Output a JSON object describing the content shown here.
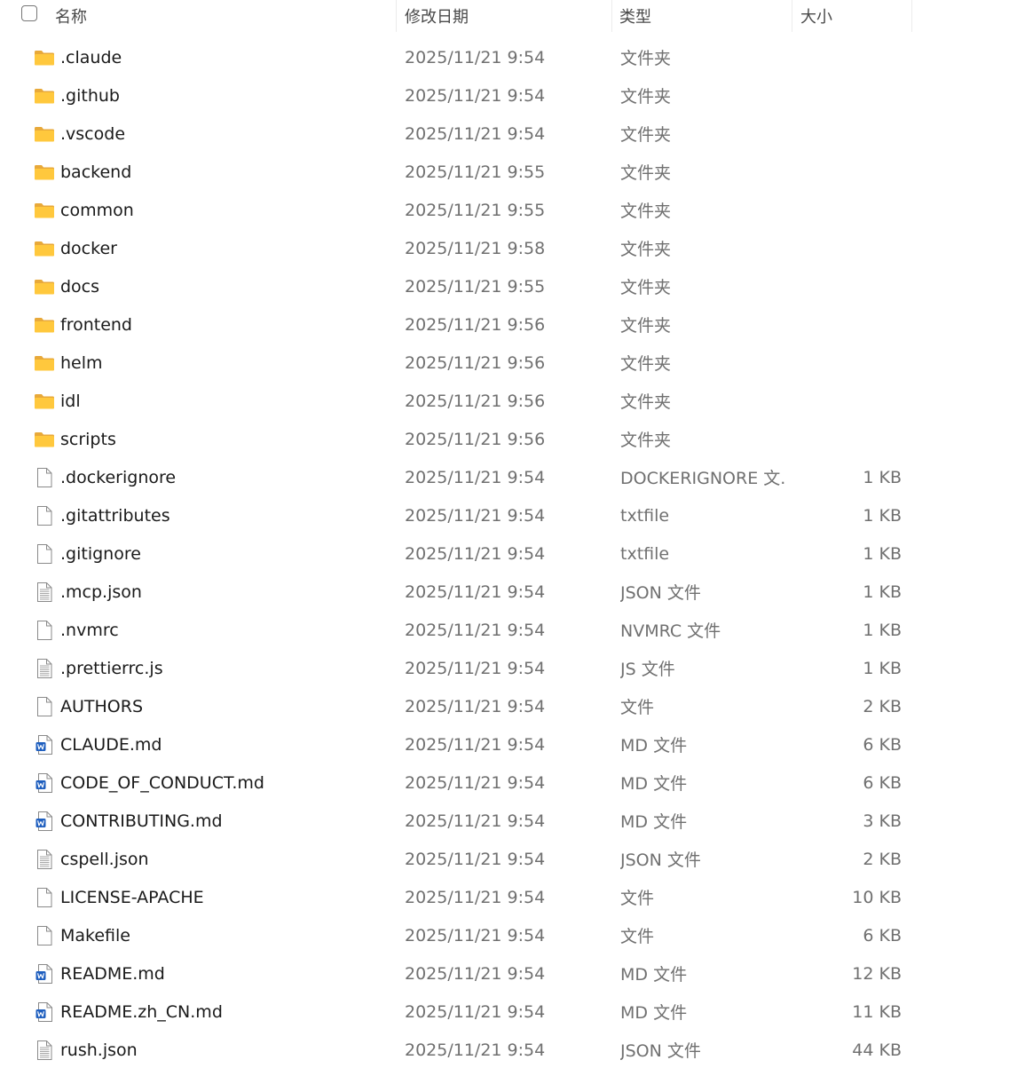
{
  "header": {
    "name_label": "名称",
    "date_label": "修改日期",
    "type_label": "类型",
    "size_label": "大小"
  },
  "files": [
    {
      "name": ".claude",
      "date": "2025/11/21 9:54",
      "type": "文件夹",
      "size": "",
      "icon": "folder-icon"
    },
    {
      "name": ".github",
      "date": "2025/11/21 9:54",
      "type": "文件夹",
      "size": "",
      "icon": "folder-icon"
    },
    {
      "name": ".vscode",
      "date": "2025/11/21 9:54",
      "type": "文件夹",
      "size": "",
      "icon": "folder-icon"
    },
    {
      "name": "backend",
      "date": "2025/11/21 9:55",
      "type": "文件夹",
      "size": "",
      "icon": "folder-icon"
    },
    {
      "name": "common",
      "date": "2025/11/21 9:55",
      "type": "文件夹",
      "size": "",
      "icon": "folder-icon"
    },
    {
      "name": "docker",
      "date": "2025/11/21 9:58",
      "type": "文件夹",
      "size": "",
      "icon": "folder-icon"
    },
    {
      "name": "docs",
      "date": "2025/11/21 9:55",
      "type": "文件夹",
      "size": "",
      "icon": "folder-icon"
    },
    {
      "name": "frontend",
      "date": "2025/11/21 9:56",
      "type": "文件夹",
      "size": "",
      "icon": "folder-icon"
    },
    {
      "name": "helm",
      "date": "2025/11/21 9:56",
      "type": "文件夹",
      "size": "",
      "icon": "folder-icon"
    },
    {
      "name": "idl",
      "date": "2025/11/21 9:56",
      "type": "文件夹",
      "size": "",
      "icon": "folder-icon"
    },
    {
      "name": "scripts",
      "date": "2025/11/21 9:56",
      "type": "文件夹",
      "size": "",
      "icon": "folder-icon"
    },
    {
      "name": ".dockerignore",
      "date": "2025/11/21 9:54",
      "type": "DOCKERIGNORE 文...",
      "size": "1 KB",
      "icon": "blank-file-icon"
    },
    {
      "name": ".gitattributes",
      "date": "2025/11/21 9:54",
      "type": "txtfile",
      "size": "1 KB",
      "icon": "blank-file-icon"
    },
    {
      "name": ".gitignore",
      "date": "2025/11/21 9:54",
      "type": "txtfile",
      "size": "1 KB",
      "icon": "blank-file-icon"
    },
    {
      "name": ".mcp.json",
      "date": "2025/11/21 9:54",
      "type": "JSON 文件",
      "size": "1 KB",
      "icon": "text-file-icon"
    },
    {
      "name": ".nvmrc",
      "date": "2025/11/21 9:54",
      "type": "NVMRC 文件",
      "size": "1 KB",
      "icon": "blank-file-icon"
    },
    {
      "name": ".prettierrc.js",
      "date": "2025/11/21 9:54",
      "type": "JS 文件",
      "size": "1 KB",
      "icon": "text-file-icon"
    },
    {
      "name": "AUTHORS",
      "date": "2025/11/21 9:54",
      "type": "文件",
      "size": "2 KB",
      "icon": "blank-file-icon"
    },
    {
      "name": "CLAUDE.md",
      "date": "2025/11/21 9:54",
      "type": "MD 文件",
      "size": "6 KB",
      "icon": "word-file-icon"
    },
    {
      "name": "CODE_OF_CONDUCT.md",
      "date": "2025/11/21 9:54",
      "type": "MD 文件",
      "size": "6 KB",
      "icon": "word-file-icon"
    },
    {
      "name": "CONTRIBUTING.md",
      "date": "2025/11/21 9:54",
      "type": "MD 文件",
      "size": "3 KB",
      "icon": "word-file-icon"
    },
    {
      "name": "cspell.json",
      "date": "2025/11/21 9:54",
      "type": "JSON 文件",
      "size": "2 KB",
      "icon": "text-file-icon"
    },
    {
      "name": "LICENSE-APACHE",
      "date": "2025/11/21 9:54",
      "type": "文件",
      "size": "10 KB",
      "icon": "blank-file-icon"
    },
    {
      "name": "Makefile",
      "date": "2025/11/21 9:54",
      "type": "文件",
      "size": "6 KB",
      "icon": "blank-file-icon"
    },
    {
      "name": "README.md",
      "date": "2025/11/21 9:54",
      "type": "MD 文件",
      "size": "12 KB",
      "icon": "word-file-icon"
    },
    {
      "name": "README.zh_CN.md",
      "date": "2025/11/21 9:54",
      "type": "MD 文件",
      "size": "11 KB",
      "icon": "word-file-icon"
    },
    {
      "name": "rush.json",
      "date": "2025/11/21 9:54",
      "type": "JSON 文件",
      "size": "44 KB",
      "icon": "text-file-icon"
    }
  ],
  "colors": {
    "folder_front": "#ffc83d",
    "folder_back": "#e8a93a",
    "word_blue": "#1f5fbf"
  }
}
